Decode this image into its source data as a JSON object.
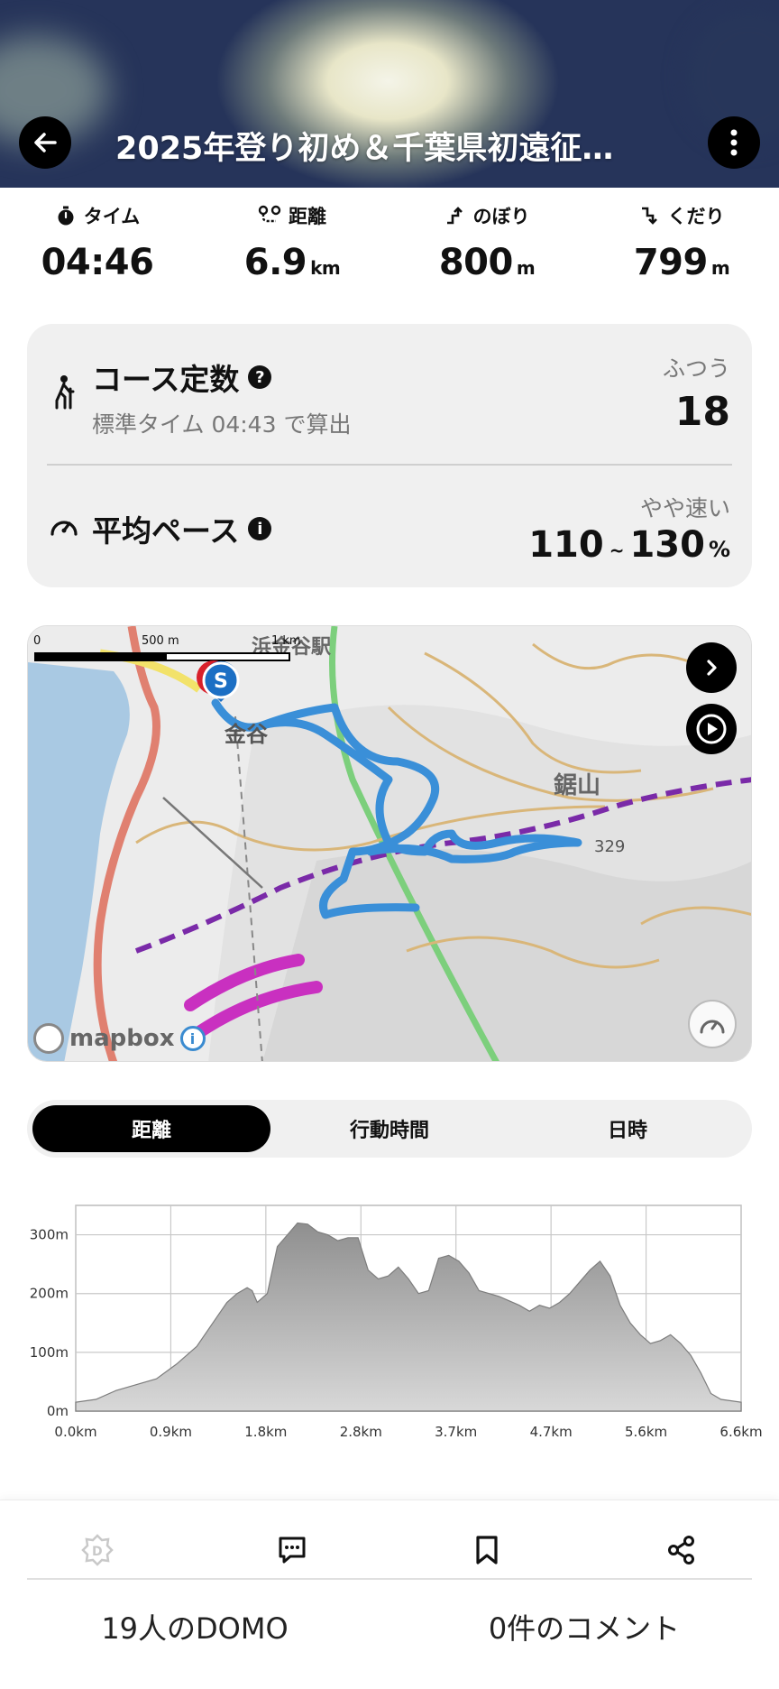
{
  "header": {
    "title": "2025年登り初め＆千葉県初遠征…"
  },
  "stats": [
    {
      "label": "タイム",
      "value": "04:46",
      "unit": "",
      "icon": "stopwatch-icon"
    },
    {
      "label": "距離",
      "value": "6.9",
      "unit": "km",
      "icon": "route-icon"
    },
    {
      "label": "のぼり",
      "value": "800",
      "unit": "m",
      "icon": "ascent-icon"
    },
    {
      "label": "くだり",
      "value": "799",
      "unit": "m",
      "icon": "descent-icon"
    }
  ],
  "course": {
    "title": "コース定数",
    "subtitle": "標準タイム 04:43 で算出",
    "level": "ふつう",
    "value": "18"
  },
  "pace": {
    "title": "平均ペース",
    "level": "やや速い",
    "low": "110",
    "tilde": "~",
    "high": "130",
    "unit": "%"
  },
  "map": {
    "scale_0": "0",
    "scale_mid": "500 m",
    "scale_end": "1 km",
    "place_kanaya": "金谷",
    "place_station": "浜金谷駅",
    "place_mountain": "鋸山",
    "peak_elevation": "329",
    "start_marker": "S",
    "logo_text": "mapbox",
    "info_glyph": "i",
    "route_color": "#3a8fd8"
  },
  "tabs": [
    {
      "label": "距離",
      "active": true
    },
    {
      "label": "行動時間",
      "active": false
    },
    {
      "label": "日時",
      "active": false
    }
  ],
  "chart_data": {
    "type": "area",
    "x_ticks": [
      "0.0km",
      "0.9km",
      "1.8km",
      "2.8km",
      "3.7km",
      "4.7km",
      "5.6km",
      "6.6km"
    ],
    "y_ticks": [
      "0m",
      "100m",
      "200m",
      "300m"
    ],
    "ylim": [
      0,
      350
    ],
    "xlim": [
      0,
      6.6
    ],
    "x": [
      0,
      0.2,
      0.4,
      0.6,
      0.8,
      1.0,
      1.2,
      1.4,
      1.5,
      1.6,
      1.7,
      1.75,
      1.8,
      1.9,
      2.0,
      2.1,
      2.2,
      2.3,
      2.4,
      2.5,
      2.6,
      2.7,
      2.8,
      2.9,
      3.0,
      3.1,
      3.2,
      3.3,
      3.4,
      3.5,
      3.6,
      3.7,
      3.8,
      3.9,
      4.0,
      4.1,
      4.2,
      4.4,
      4.5,
      4.6,
      4.7,
      4.8,
      4.9,
      5.0,
      5.1,
      5.2,
      5.3,
      5.4,
      5.5,
      5.6,
      5.7,
      5.8,
      5.9,
      6.0,
      6.1,
      6.2,
      6.3,
      6.4,
      6.6
    ],
    "y": [
      15,
      20,
      35,
      45,
      55,
      80,
      110,
      160,
      185,
      200,
      210,
      205,
      185,
      200,
      280,
      300,
      320,
      318,
      305,
      300,
      290,
      295,
      295,
      240,
      225,
      230,
      245,
      225,
      200,
      205,
      260,
      265,
      255,
      235,
      205,
      200,
      195,
      180,
      170,
      180,
      175,
      185,
      200,
      220,
      240,
      255,
      230,
      180,
      150,
      130,
      115,
      120,
      130,
      115,
      95,
      65,
      30,
      20,
      15
    ],
    "fill_color": "#9a9a9a"
  },
  "bottom": {
    "domo_count": "19人のDOMO",
    "comment_count": "0件のコメント"
  }
}
